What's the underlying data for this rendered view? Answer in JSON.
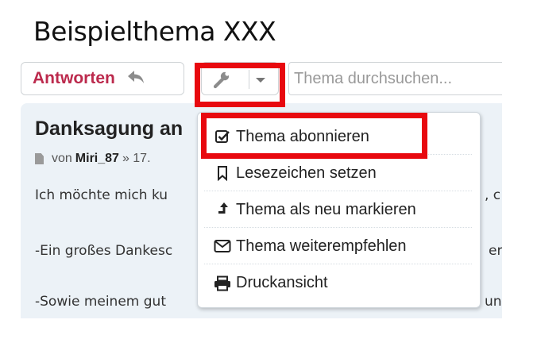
{
  "page": {
    "title": "Beispielthema XXX"
  },
  "toolbar": {
    "reply_label": "Antworten",
    "reply_icon": "reply-icon",
    "tools_icon": "wrench-icon",
    "search_placeholder": "Thema durchsuchen..."
  },
  "post": {
    "title": "Danksagung an",
    "meta_prefix": "von",
    "author": "Miri_87",
    "meta_suffix": "» 17.",
    "lines": [
      "Ich möchte mich ku",
      "-Ein großes Dankesc",
      "-Sowie meinem gut"
    ],
    "right_fragments": [
      ", c",
      "er",
      "unc"
    ]
  },
  "dropdown": {
    "items": [
      {
        "label": "Thema abonnieren",
        "icon": "checkbox-checked-icon"
      },
      {
        "label": "Lesezeichen setzen",
        "icon": "bookmark-icon"
      },
      {
        "label": "Thema als neu markieren",
        "icon": "arrow-up-icon"
      },
      {
        "label": "Thema weiterempfehlen",
        "icon": "envelope-icon"
      },
      {
        "label": "Druckansicht",
        "icon": "print-icon"
      }
    ]
  },
  "colors": {
    "highlight": "#e8090f",
    "reply_text": "#bc2a4d",
    "post_background": "#ecf2f7"
  }
}
